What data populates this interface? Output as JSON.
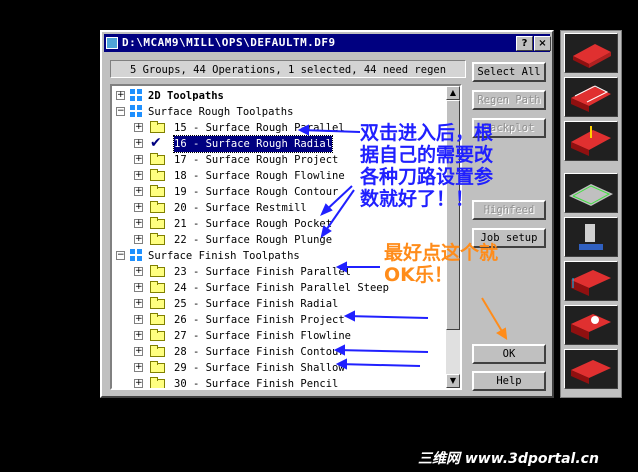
{
  "window": {
    "title": "D:\\MCAM9\\MILL\\OPS\\DEFAULTM.DF9",
    "help_btn": "?",
    "close_btn": "×"
  },
  "status": "5 Groups, 44 Operations, 1 selected, 44 need regen",
  "tree": {
    "group_2d": "2D Toolpaths",
    "group_rough": "Surface Rough Toolpaths",
    "rough_items": [
      "15 - Surface Rough Parallel",
      "16 - Surface Rough Radial",
      "17 - Surface Rough Project",
      "18 - Surface Rough Flowline",
      "19 - Surface Rough Contour",
      "20 - Surface Restmill",
      "21 - Surface Rough Pocket",
      "22 - Surface Rough Plunge"
    ],
    "group_finish": "Surface Finish Toolpaths",
    "finish_items": [
      "23 - Surface Finish Parallel",
      "24 - Surface Finish Parallel Steep",
      "25 - Surface Finish Radial",
      "26 - Surface Finish Project",
      "27 - Surface Finish Flowline",
      "28 - Surface Finish Contour",
      "29 - Surface Finish Shallow",
      "30 - Surface Finish Pencil"
    ]
  },
  "buttons": {
    "select_all": "Select All",
    "regen_path": "Regen Path",
    "backplot": "Backplot",
    "highfeed": "Highfeed",
    "job_setup": "Job setup",
    "ok": "OK",
    "help": "Help"
  },
  "annotations": {
    "blue_note": [
      "双击进入后，根",
      "据自己的需要改",
      "各种刀路设置参",
      "数就好了！！"
    ],
    "orange_note": [
      "最好点这个就",
      "OK乐！"
    ]
  },
  "watermark": "三维网 www.3dportal.cn",
  "colors": {
    "title_bar": "#000080",
    "note_blue": "#2020ff",
    "note_orange": "#ff8c1a"
  }
}
